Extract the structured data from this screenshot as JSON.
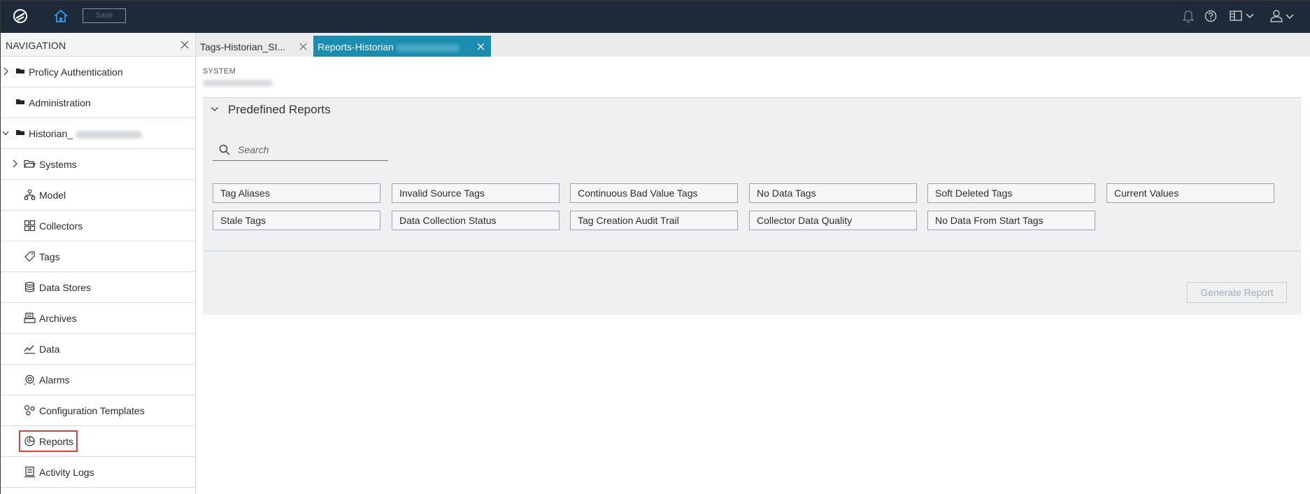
{
  "topbar": {
    "save_label": "Save",
    "icons": [
      "app-logo-icon",
      "home-icon",
      "bell-icon",
      "help-icon",
      "layout-icon",
      "user-icon"
    ]
  },
  "navigation": {
    "title": "NAVIGATION",
    "items": [
      {
        "label": "Proficy Authentication",
        "icon": "folder-icon"
      },
      {
        "label": "Administration",
        "icon": "folder-icon"
      },
      {
        "label": "Historian_",
        "icon": "folder-icon"
      },
      {
        "label": "Systems",
        "icon": "folder-open-icon"
      },
      {
        "label": "Model",
        "icon": "model-icon"
      },
      {
        "label": "Collectors",
        "icon": "grid-icon"
      },
      {
        "label": "Tags",
        "icon": "tag-icon"
      },
      {
        "label": "Data Stores",
        "icon": "database-icon"
      },
      {
        "label": "Archives",
        "icon": "archive-icon"
      },
      {
        "label": "Data",
        "icon": "line-chart-icon"
      },
      {
        "label": "Alarms",
        "icon": "alarm-icon"
      },
      {
        "label": "Configuration Templates",
        "icon": "config-icon"
      },
      {
        "label": "Reports",
        "icon": "pie-chart-icon"
      },
      {
        "label": "Activity Logs",
        "icon": "log-icon"
      }
    ]
  },
  "tabs": [
    {
      "label": "Tags-Historian_SI...",
      "active": false
    },
    {
      "label": "Reports-Historian",
      "active": true
    }
  ],
  "content": {
    "system_label": "SYSTEM",
    "panel_title": "Predefined Reports",
    "search_placeholder": "Search",
    "reports": [
      "Tag Aliases",
      "Invalid Source Tags",
      "Continuous Bad Value Tags",
      "No Data Tags",
      "Soft Deleted Tags",
      "Current Values",
      "Stale Tags",
      "Data Collection Status",
      "Tag Creation Audit Trail",
      "Collector Data Quality",
      "No Data From Start Tags"
    ],
    "generate_label": "Generate Report"
  },
  "colors": {
    "topbar": "#1e2a37",
    "active_tab": "#1b8db0",
    "highlight": "#e0403a"
  }
}
